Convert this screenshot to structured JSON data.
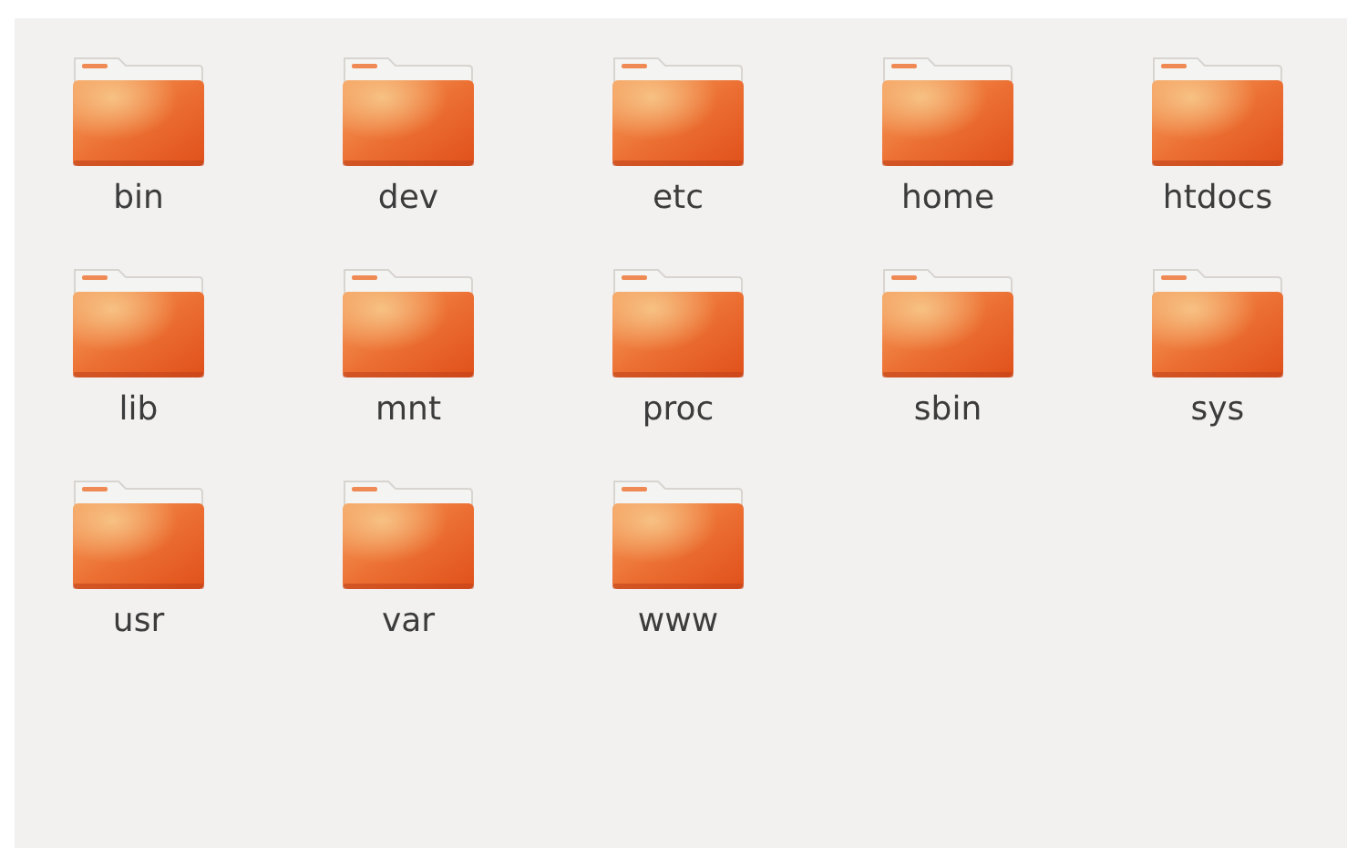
{
  "folders": [
    {
      "name": "bin"
    },
    {
      "name": "dev"
    },
    {
      "name": "etc"
    },
    {
      "name": "home"
    },
    {
      "name": "htdocs"
    },
    {
      "name": "lib"
    },
    {
      "name": "mnt"
    },
    {
      "name": "proc"
    },
    {
      "name": "sbin"
    },
    {
      "name": "sys"
    },
    {
      "name": "usr"
    },
    {
      "name": "var"
    },
    {
      "name": "www"
    }
  ]
}
